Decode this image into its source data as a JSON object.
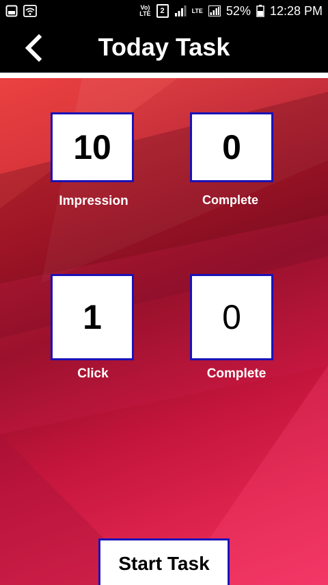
{
  "status_bar": {
    "volte_line1": "Vo)",
    "volte_line2": "LTE",
    "sim_slot": "2",
    "lte_label": "LTE",
    "battery_percent": "52%",
    "time": "12:28 PM",
    "icons": [
      "gallery-icon",
      "wifi-icon",
      "signal-icon",
      "battery-icon"
    ]
  },
  "header": {
    "title": "Today Task",
    "back_icon": "chevron-left-icon"
  },
  "stats": {
    "impression": {
      "value": "10",
      "label": "Impression"
    },
    "impression_complete": {
      "value": "0",
      "label": "Complete"
    },
    "click": {
      "value": "1",
      "label": "Click"
    },
    "click_complete": {
      "value": "0",
      "label": "Complete"
    }
  },
  "actions": {
    "start_label": "Start Task"
  },
  "colors": {
    "header_bg": "#000000",
    "box_border": "#1a12b8",
    "gradient_top": "#e83a3a",
    "gradient_mid": "#8c0e23",
    "gradient_bottom": "#f03160"
  }
}
